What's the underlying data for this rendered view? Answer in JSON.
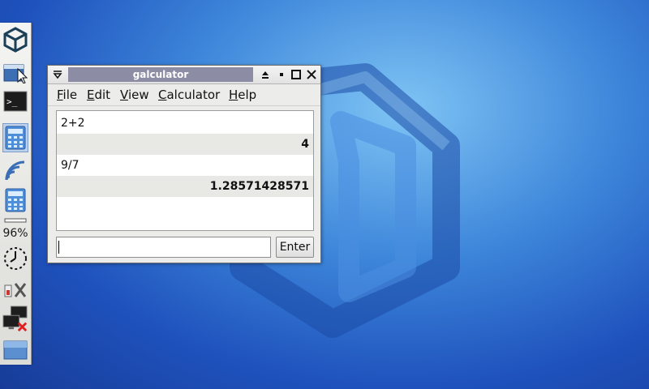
{
  "window": {
    "title": "galculator"
  },
  "menu": [
    {
      "mnemonic": "F",
      "rest": "ile"
    },
    {
      "mnemonic": "E",
      "rest": "dit"
    },
    {
      "mnemonic": "V",
      "rest": "iew"
    },
    {
      "mnemonic": "C",
      "rest": "alculator"
    },
    {
      "mnemonic": "H",
      "rest": "elp"
    }
  ],
  "history": [
    {
      "expression": "2+2",
      "result": "4"
    },
    {
      "expression": "9/7",
      "result": "1.28571428571"
    }
  ],
  "input": {
    "value": "",
    "enter_label": "Enter"
  },
  "taskbar": {
    "battery_text": "96%",
    "icons": [
      "app-menu-icon",
      "file-manager-icon",
      "terminal-icon",
      "calculator-icon",
      "wireless-icon",
      "calculator-launcher-icon",
      "battery-icon",
      "clock-icon",
      "settings-icon",
      "network-disconnected-icon",
      "show-desktop-icon"
    ]
  },
  "colors": {
    "title_bar": "#8c8ca4",
    "desktop": "#2f6fd0",
    "result_row": "#e8e8e5"
  }
}
